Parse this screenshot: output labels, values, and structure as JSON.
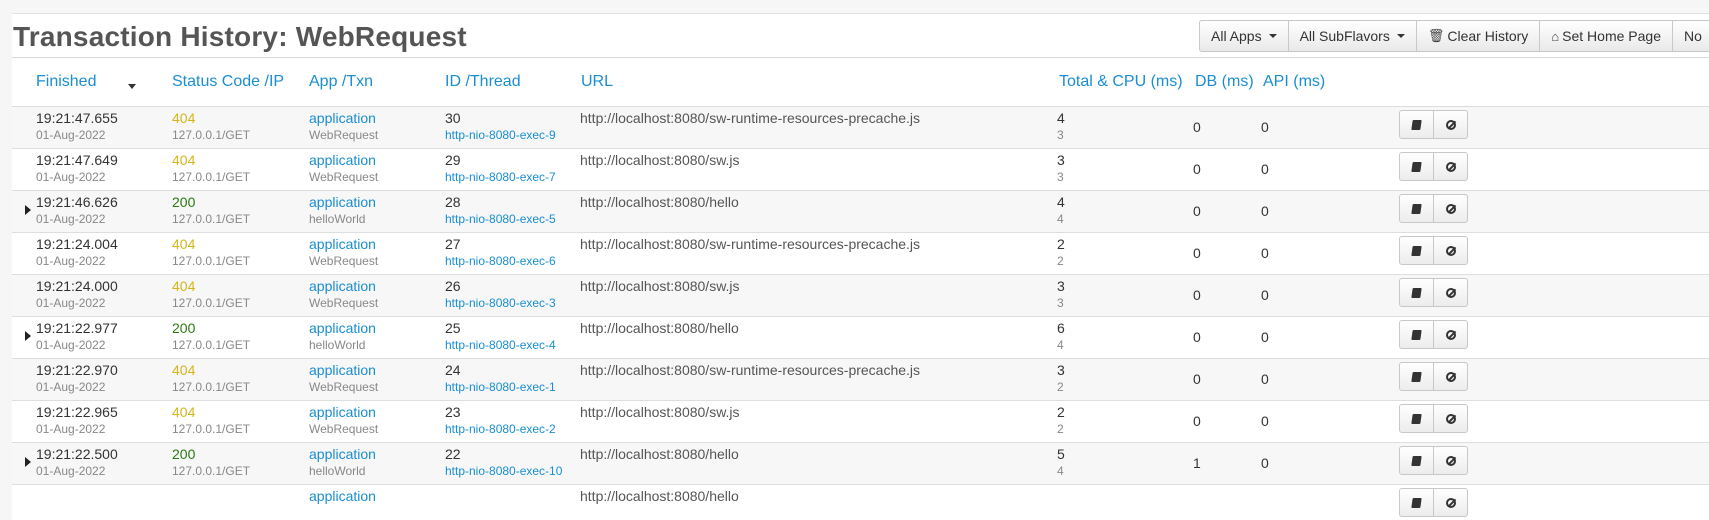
{
  "page_title": "Transaction History: WebRequest",
  "toolbar": {
    "all_apps": "All Apps",
    "all_subflavors": "All SubFlavors",
    "clear_history": "Clear History",
    "set_home_page": "Set Home Page",
    "truncated": "No"
  },
  "columns": {
    "finished": "Finished",
    "status": "Status Code /IP",
    "app": "App /Txn",
    "id": "ID /Thread",
    "url": "URL",
    "total": "Total & CPU (ms)",
    "db": "DB (ms)",
    "api": "API (ms)"
  },
  "rows": [
    {
      "time": "19:21:47.655",
      "date": "01-Aug-2022",
      "status": "404",
      "ip": "127.0.0.1/GET",
      "app": "application",
      "txn": "WebRequest",
      "id": "30",
      "thread": "http-nio-8080-exec-9",
      "url": "http://localhost:8080/sw-runtime-resources-precache.js",
      "total": "4",
      "cpu": "3",
      "db": "0",
      "api": "0",
      "expandable": false
    },
    {
      "time": "19:21:47.649",
      "date": "01-Aug-2022",
      "status": "404",
      "ip": "127.0.0.1/GET",
      "app": "application",
      "txn": "WebRequest",
      "id": "29",
      "thread": "http-nio-8080-exec-7",
      "url": "http://localhost:8080/sw.js",
      "total": "3",
      "cpu": "3",
      "db": "0",
      "api": "0",
      "expandable": false
    },
    {
      "time": "19:21:46.626",
      "date": "01-Aug-2022",
      "status": "200",
      "ip": "127.0.0.1/GET",
      "app": "application",
      "txn": "helloWorld",
      "id": "28",
      "thread": "http-nio-8080-exec-5",
      "url": "http://localhost:8080/hello",
      "total": "4",
      "cpu": "4",
      "db": "0",
      "api": "0",
      "expandable": true
    },
    {
      "time": "19:21:24.004",
      "date": "01-Aug-2022",
      "status": "404",
      "ip": "127.0.0.1/GET",
      "app": "application",
      "txn": "WebRequest",
      "id": "27",
      "thread": "http-nio-8080-exec-6",
      "url": "http://localhost:8080/sw-runtime-resources-precache.js",
      "total": "2",
      "cpu": "2",
      "db": "0",
      "api": "0",
      "expandable": false
    },
    {
      "time": "19:21:24.000",
      "date": "01-Aug-2022",
      "status": "404",
      "ip": "127.0.0.1/GET",
      "app": "application",
      "txn": "WebRequest",
      "id": "26",
      "thread": "http-nio-8080-exec-3",
      "url": "http://localhost:8080/sw.js",
      "total": "3",
      "cpu": "3",
      "db": "0",
      "api": "0",
      "expandable": false
    },
    {
      "time": "19:21:22.977",
      "date": "01-Aug-2022",
      "status": "200",
      "ip": "127.0.0.1/GET",
      "app": "application",
      "txn": "helloWorld",
      "id": "25",
      "thread": "http-nio-8080-exec-4",
      "url": "http://localhost:8080/hello",
      "total": "6",
      "cpu": "4",
      "db": "0",
      "api": "0",
      "expandable": true
    },
    {
      "time": "19:21:22.970",
      "date": "01-Aug-2022",
      "status": "404",
      "ip": "127.0.0.1/GET",
      "app": "application",
      "txn": "WebRequest",
      "id": "24",
      "thread": "http-nio-8080-exec-1",
      "url": "http://localhost:8080/sw-runtime-resources-precache.js",
      "total": "3",
      "cpu": "2",
      "db": "0",
      "api": "0",
      "expandable": false
    },
    {
      "time": "19:21:22.965",
      "date": "01-Aug-2022",
      "status": "404",
      "ip": "127.0.0.1/GET",
      "app": "application",
      "txn": "WebRequest",
      "id": "23",
      "thread": "http-nio-8080-exec-2",
      "url": "http://localhost:8080/sw.js",
      "total": "2",
      "cpu": "2",
      "db": "0",
      "api": "0",
      "expandable": false
    },
    {
      "time": "19:21:22.500",
      "date": "01-Aug-2022",
      "status": "200",
      "ip": "127.0.0.1/GET",
      "app": "application",
      "txn": "helloWorld",
      "id": "22",
      "thread": "http-nio-8080-exec-10",
      "url": "http://localhost:8080/hello",
      "total": "5",
      "cpu": "4",
      "db": "1",
      "api": "0",
      "expandable": true
    },
    {
      "time": "",
      "date": "",
      "status": "",
      "ip": "",
      "app": "application",
      "txn": "",
      "id": "",
      "thread": "",
      "url": "http://localhost:8080/hello",
      "total": "",
      "cpu": "",
      "db": "",
      "api": "",
      "expandable": false
    }
  ],
  "icons": {
    "view_details": "book-icon",
    "block": "ban-icon",
    "clear": "trash-icon",
    "home": "home-icon"
  },
  "colors": {
    "link": "#1a8ed3",
    "status_404": "#d4b51a",
    "status_200": "#2a7a14"
  }
}
